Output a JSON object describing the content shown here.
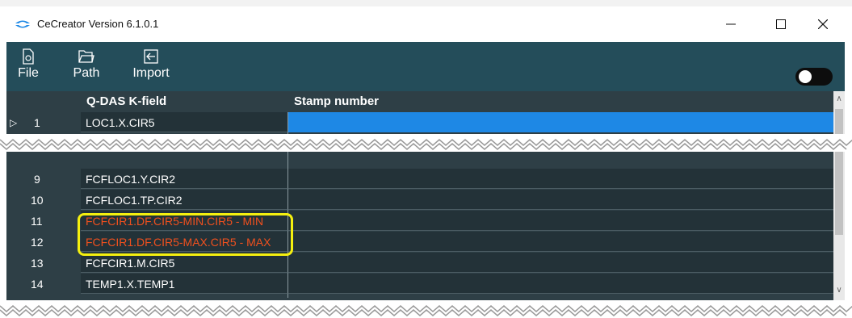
{
  "window": {
    "title": "CeCreator Version 6.1.0.1"
  },
  "titlebar": {
    "minimize_icon": "minimize-icon",
    "maximize_icon": "maximize-icon",
    "close_icon": "close-icon"
  },
  "toolbar": {
    "buttons": [
      {
        "label": "File",
        "icon": "file-icon"
      },
      {
        "label": "Path",
        "icon": "folder-icon"
      },
      {
        "label": "Import",
        "icon": "import-icon"
      }
    ],
    "toggle": {
      "state": "off"
    }
  },
  "grid": {
    "columns": [
      "Q-DAS K-field",
      "Stamp number"
    ],
    "rows": [
      {
        "num": "1",
        "kfield": "LOC1.X.CIR5",
        "stamp": "",
        "selected": true,
        "highlight": false
      },
      {
        "num": "9",
        "kfield": "FCFLOC1.Y.CIR2",
        "stamp": "",
        "selected": false,
        "highlight": false
      },
      {
        "num": "10",
        "kfield": "FCFLOC1.TP.CIR2",
        "stamp": "",
        "selected": false,
        "highlight": false
      },
      {
        "num": "11",
        "kfield": "FCFCIR1.DF.CIR5-MIN.CIR5 - MIN",
        "stamp": "",
        "selected": false,
        "highlight": true
      },
      {
        "num": "12",
        "kfield": "FCFCIR1.DF.CIR5-MAX.CIR5 - MAX",
        "stamp": "",
        "selected": false,
        "highlight": true
      },
      {
        "num": "13",
        "kfield": "FCFCIR1.M.CIR5",
        "stamp": "",
        "selected": false,
        "highlight": false
      },
      {
        "num": "14",
        "kfield": "TEMP1.X.TEMP1",
        "stamp": "",
        "selected": false,
        "highlight": false
      }
    ]
  },
  "colors": {
    "toolbar_bg": "#244d5a",
    "grid_bg": "#2e3f46",
    "selection": "#1e88e5",
    "highlight_text": "#f0501e",
    "callout_border": "#f5f00f"
  }
}
